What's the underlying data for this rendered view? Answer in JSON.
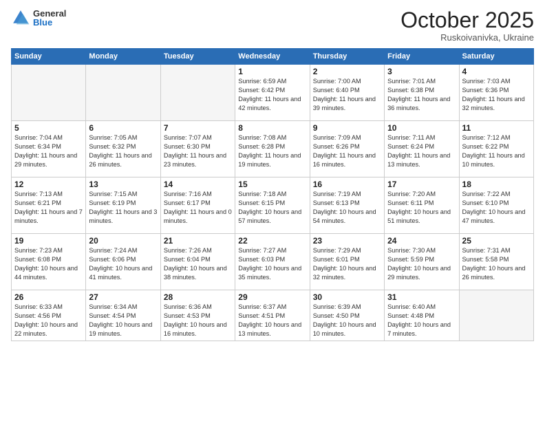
{
  "logo": {
    "general": "General",
    "blue": "Blue"
  },
  "header": {
    "month": "October 2025",
    "location": "Ruskoivanivka, Ukraine"
  },
  "weekdays": [
    "Sunday",
    "Monday",
    "Tuesday",
    "Wednesday",
    "Thursday",
    "Friday",
    "Saturday"
  ],
  "weeks": [
    [
      {
        "day": "",
        "info": ""
      },
      {
        "day": "",
        "info": ""
      },
      {
        "day": "",
        "info": ""
      },
      {
        "day": "1",
        "info": "Sunrise: 6:59 AM\nSunset: 6:42 PM\nDaylight: 11 hours\nand 42 minutes."
      },
      {
        "day": "2",
        "info": "Sunrise: 7:00 AM\nSunset: 6:40 PM\nDaylight: 11 hours\nand 39 minutes."
      },
      {
        "day": "3",
        "info": "Sunrise: 7:01 AM\nSunset: 6:38 PM\nDaylight: 11 hours\nand 36 minutes."
      },
      {
        "day": "4",
        "info": "Sunrise: 7:03 AM\nSunset: 6:36 PM\nDaylight: 11 hours\nand 32 minutes."
      }
    ],
    [
      {
        "day": "5",
        "info": "Sunrise: 7:04 AM\nSunset: 6:34 PM\nDaylight: 11 hours\nand 29 minutes."
      },
      {
        "day": "6",
        "info": "Sunrise: 7:05 AM\nSunset: 6:32 PM\nDaylight: 11 hours\nand 26 minutes."
      },
      {
        "day": "7",
        "info": "Sunrise: 7:07 AM\nSunset: 6:30 PM\nDaylight: 11 hours\nand 23 minutes."
      },
      {
        "day": "8",
        "info": "Sunrise: 7:08 AM\nSunset: 6:28 PM\nDaylight: 11 hours\nand 19 minutes."
      },
      {
        "day": "9",
        "info": "Sunrise: 7:09 AM\nSunset: 6:26 PM\nDaylight: 11 hours\nand 16 minutes."
      },
      {
        "day": "10",
        "info": "Sunrise: 7:11 AM\nSunset: 6:24 PM\nDaylight: 11 hours\nand 13 minutes."
      },
      {
        "day": "11",
        "info": "Sunrise: 7:12 AM\nSunset: 6:22 PM\nDaylight: 11 hours\nand 10 minutes."
      }
    ],
    [
      {
        "day": "12",
        "info": "Sunrise: 7:13 AM\nSunset: 6:21 PM\nDaylight: 11 hours\nand 7 minutes."
      },
      {
        "day": "13",
        "info": "Sunrise: 7:15 AM\nSunset: 6:19 PM\nDaylight: 11 hours\nand 3 minutes."
      },
      {
        "day": "14",
        "info": "Sunrise: 7:16 AM\nSunset: 6:17 PM\nDaylight: 11 hours\nand 0 minutes."
      },
      {
        "day": "15",
        "info": "Sunrise: 7:18 AM\nSunset: 6:15 PM\nDaylight: 10 hours\nand 57 minutes."
      },
      {
        "day": "16",
        "info": "Sunrise: 7:19 AM\nSunset: 6:13 PM\nDaylight: 10 hours\nand 54 minutes."
      },
      {
        "day": "17",
        "info": "Sunrise: 7:20 AM\nSunset: 6:11 PM\nDaylight: 10 hours\nand 51 minutes."
      },
      {
        "day": "18",
        "info": "Sunrise: 7:22 AM\nSunset: 6:10 PM\nDaylight: 10 hours\nand 47 minutes."
      }
    ],
    [
      {
        "day": "19",
        "info": "Sunrise: 7:23 AM\nSunset: 6:08 PM\nDaylight: 10 hours\nand 44 minutes."
      },
      {
        "day": "20",
        "info": "Sunrise: 7:24 AM\nSunset: 6:06 PM\nDaylight: 10 hours\nand 41 minutes."
      },
      {
        "day": "21",
        "info": "Sunrise: 7:26 AM\nSunset: 6:04 PM\nDaylight: 10 hours\nand 38 minutes."
      },
      {
        "day": "22",
        "info": "Sunrise: 7:27 AM\nSunset: 6:03 PM\nDaylight: 10 hours\nand 35 minutes."
      },
      {
        "day": "23",
        "info": "Sunrise: 7:29 AM\nSunset: 6:01 PM\nDaylight: 10 hours\nand 32 minutes."
      },
      {
        "day": "24",
        "info": "Sunrise: 7:30 AM\nSunset: 5:59 PM\nDaylight: 10 hours\nand 29 minutes."
      },
      {
        "day": "25",
        "info": "Sunrise: 7:31 AM\nSunset: 5:58 PM\nDaylight: 10 hours\nand 26 minutes."
      }
    ],
    [
      {
        "day": "26",
        "info": "Sunrise: 6:33 AM\nSunset: 4:56 PM\nDaylight: 10 hours\nand 22 minutes."
      },
      {
        "day": "27",
        "info": "Sunrise: 6:34 AM\nSunset: 4:54 PM\nDaylight: 10 hours\nand 19 minutes."
      },
      {
        "day": "28",
        "info": "Sunrise: 6:36 AM\nSunset: 4:53 PM\nDaylight: 10 hours\nand 16 minutes."
      },
      {
        "day": "29",
        "info": "Sunrise: 6:37 AM\nSunset: 4:51 PM\nDaylight: 10 hours\nand 13 minutes."
      },
      {
        "day": "30",
        "info": "Sunrise: 6:39 AM\nSunset: 4:50 PM\nDaylight: 10 hours\nand 10 minutes."
      },
      {
        "day": "31",
        "info": "Sunrise: 6:40 AM\nSunset: 4:48 PM\nDaylight: 10 hours\nand 7 minutes."
      },
      {
        "day": "",
        "info": ""
      }
    ]
  ]
}
